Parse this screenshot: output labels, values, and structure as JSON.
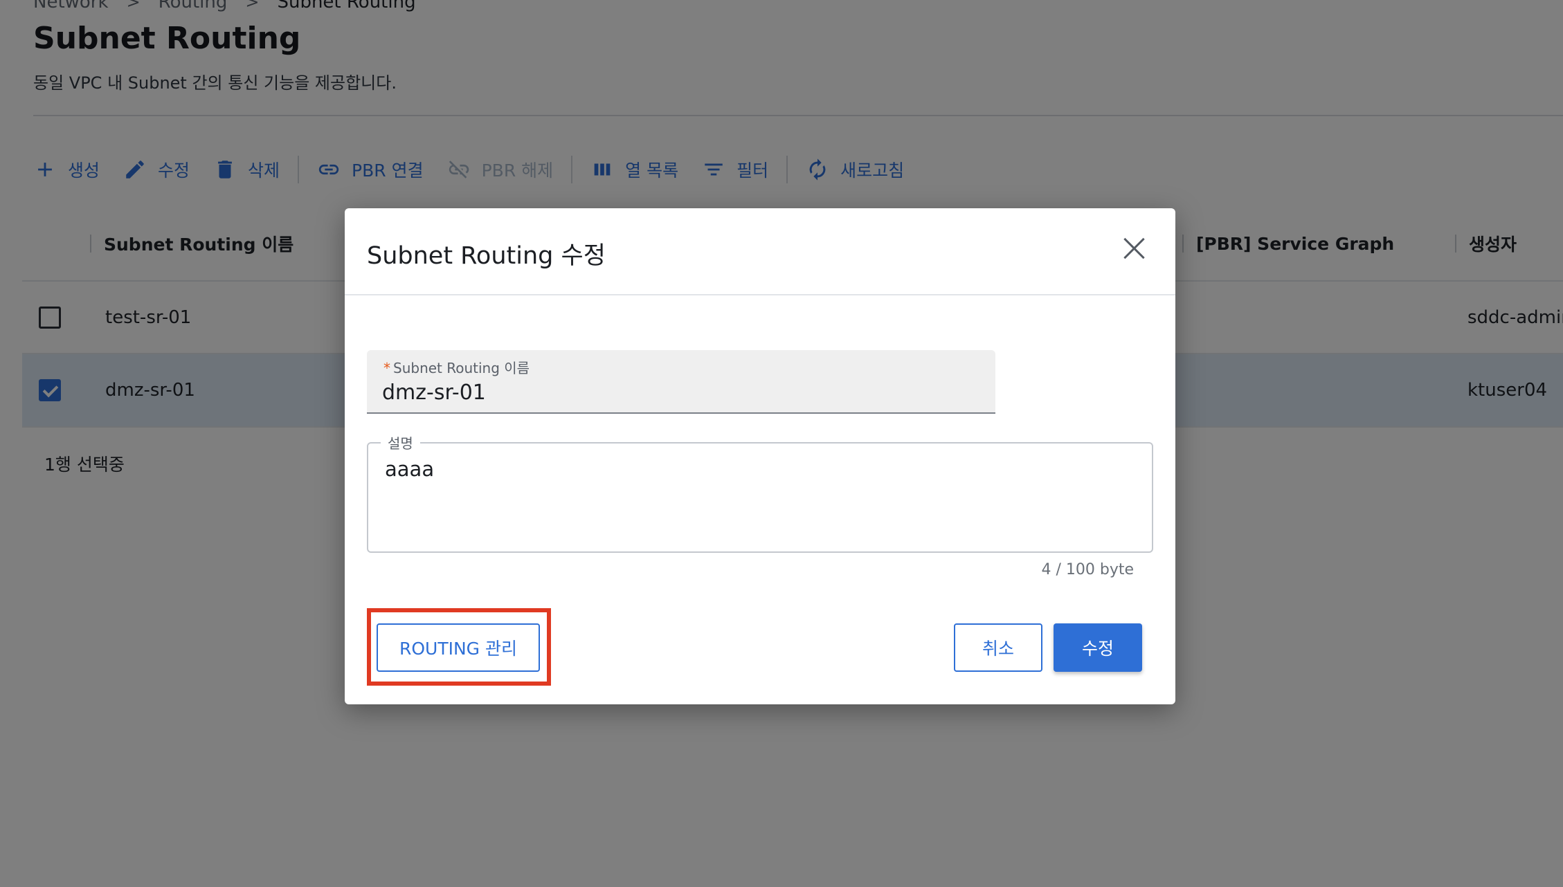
{
  "breadcrumb": {
    "items": [
      "Network",
      "Routing",
      "Subnet Routing"
    ],
    "separator": ">"
  },
  "page": {
    "title": "Subnet Routing",
    "description": "동일 VPC 내 Subnet 간의 통신 기능을 제공합니다."
  },
  "toolbar": {
    "create": "생성",
    "edit": "수정",
    "delete": "삭제",
    "pbr_connect": "PBR 연결",
    "pbr_disconnect": "PBR 해제",
    "column_list": "열 목록",
    "filter": "필터",
    "refresh": "새로고침"
  },
  "table": {
    "columns": [
      "Subnet Routing 이름",
      "[PBR] Service Graph",
      "생성자"
    ],
    "rows": [
      {
        "name": "test-sr-01",
        "creator": "sddc-admin",
        "checked": false
      },
      {
        "name": "dmz-sr-01",
        "creator": "ktuser04",
        "checked": true
      }
    ],
    "selected_count": "1행 선택중"
  },
  "modal": {
    "title": "Subnet Routing 수정",
    "name_label": "Subnet Routing 이름",
    "required_mark": "*",
    "name_value": "dmz-sr-01",
    "desc_label": "설명",
    "desc_value": "aaaa",
    "byte_count": "4 / 100 byte",
    "routing_button": "ROUTING 관리",
    "cancel_button": "취소",
    "submit_button": "수정"
  },
  "colors": {
    "accent": "#2e6fd6",
    "highlight": "#e03a22",
    "required": "#e55a1b"
  }
}
